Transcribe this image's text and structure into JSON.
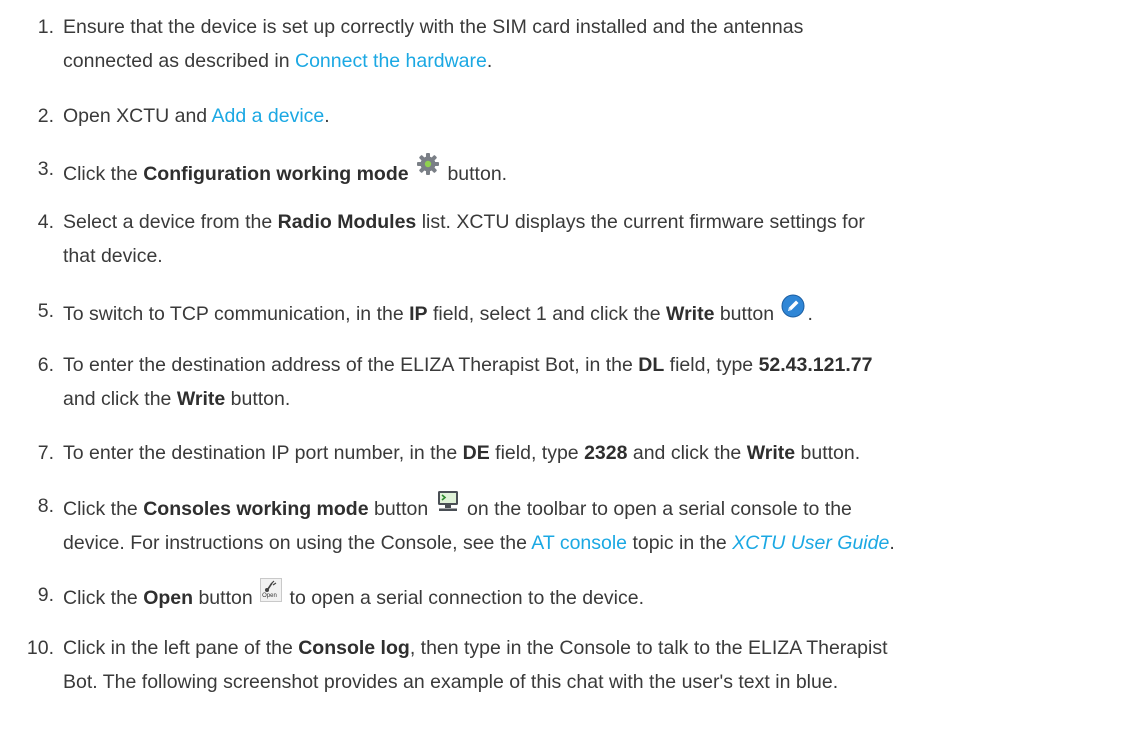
{
  "steps": [
    {
      "n": "1.",
      "a": "Ensure that the device is set up correctly with the SIM card installed and the antennas",
      "b": "connected as described in ",
      "link": "Connect the hardware",
      "c": "."
    },
    {
      "n": "2.",
      "a": "Open XCTU and ",
      "link": "Add a device",
      "b": "."
    },
    {
      "n": "3.",
      "a": "Click the ",
      "bold": "Configuration working mode",
      "b": " button.",
      "icon": "gear-icon"
    },
    {
      "n": "4.",
      "a": "Select a device from the ",
      "bold": "Radio Modules",
      "b": " list. XCTU displays the current firmware settings for",
      "c": "that device."
    },
    {
      "n": "5.",
      "a": "To switch to TCP communication, in the ",
      "bold1": "IP",
      "b": " field, select 1 and click the ",
      "bold2": "Write",
      "c": " button ",
      "d": ".",
      "icon": "write-pencil-icon"
    },
    {
      "n": "6.",
      "a": "To enter the destination address of the ELIZA Therapist Bot, in the ",
      "bold1": "DL",
      "b": " field, type ",
      "bold2": "52.43.121.77",
      "c": "and click the ",
      "bold3": "Write",
      "d": " button."
    },
    {
      "n": "7.",
      "a": "To enter the destination IP port number, in the ",
      "bold1": "DE",
      "b": " field, type ",
      "bold2": "2328",
      "c": " and click the ",
      "bold3": "Write",
      "d": " button."
    },
    {
      "n": "8.",
      "a": "Click the ",
      "bold": "Consoles working mode",
      "b": " button ",
      "c": " on the toolbar to open a serial console to the",
      "d": "device. For instructions on using the Console, see the ",
      "link1": "AT console",
      "e": " topic in the ",
      "link2": "XCTU User Guide",
      "f": ".",
      "icon": "console-monitor-icon"
    },
    {
      "n": "9.",
      "a": "Click the ",
      "bold": "Open",
      "b": " button ",
      "c": " to open a serial connection to the device.",
      "icon": "open-connection-icon",
      "icon_label": "Open"
    },
    {
      "n": "10.",
      "a": "Click in the left pane of the ",
      "bold": "Console log",
      "b": ", then type in the Console to talk to the ELIZA Therapist",
      "c": "Bot. The following screenshot provides an example of this chat with the user's text in blue."
    }
  ],
  "colors": {
    "link": "#1ba8e3",
    "text": "#3a3a3a"
  }
}
